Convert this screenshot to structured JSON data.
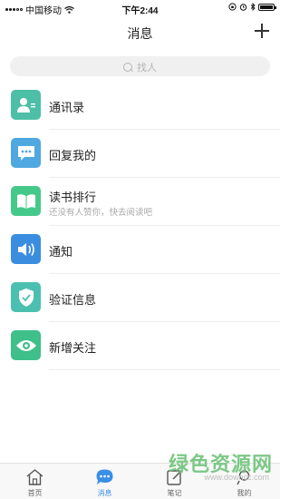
{
  "status_bar": {
    "carrier": "中国移动",
    "time": "下午2:44"
  },
  "header": {
    "title": "消息"
  },
  "search": {
    "placeholder": "找人"
  },
  "menu": [
    {
      "label": "通讯录",
      "icon": "contacts-icon",
      "color": "#4dbfa6"
    },
    {
      "label": "回复我的",
      "icon": "comment-icon",
      "color": "#4fa8e0"
    },
    {
      "label": "读书排行",
      "subtitle": "还没有人赞你，快去阅读吧",
      "icon": "book-icon",
      "color": "#45c98a"
    },
    {
      "label": "通知",
      "icon": "speaker-icon",
      "color": "#3b8de0"
    },
    {
      "label": "验证信息",
      "icon": "shield-icon",
      "color": "#4cc0b0"
    },
    {
      "label": "新增关注",
      "icon": "eye-icon",
      "color": "#3fbf8a"
    }
  ],
  "tab_bar": {
    "tabs": [
      {
        "label": "首页",
        "icon": "home-icon"
      },
      {
        "label": "消息",
        "icon": "message-icon",
        "active": true
      },
      {
        "label": "笔记",
        "icon": "note-icon"
      },
      {
        "label": "我的",
        "icon": "profile-icon"
      }
    ],
    "active_color": "#3a8ee6"
  },
  "watermark": {
    "main": "绿色资源网",
    "sub": "www.downcc.com"
  },
  "colors": {
    "accent": "#3a8ee6"
  }
}
